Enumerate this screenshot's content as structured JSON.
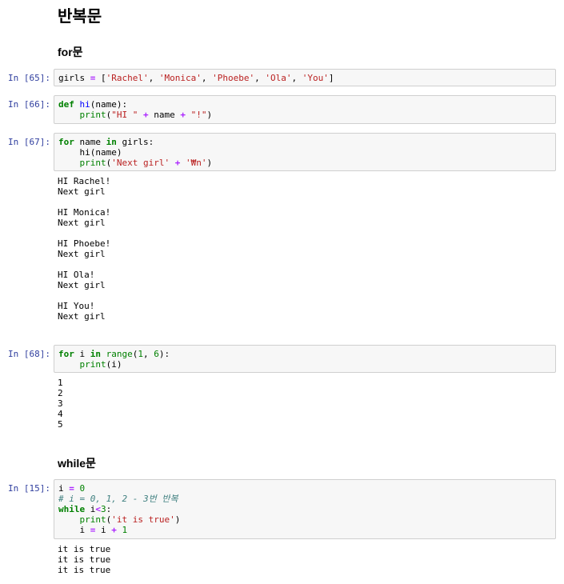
{
  "title": "반복문",
  "sections": {
    "for": "for문",
    "while": "while문"
  },
  "cells": [
    {
      "prompt": "In [65]:",
      "lines": [
        [
          [
            "t",
            "girls "
          ],
          [
            "op",
            "="
          ],
          [
            "t",
            " ["
          ],
          [
            "str",
            "'Rachel'"
          ],
          [
            "t",
            ", "
          ],
          [
            "str",
            "'Monica'"
          ],
          [
            "t",
            ", "
          ],
          [
            "str",
            "'Phoebe'"
          ],
          [
            "t",
            ", "
          ],
          [
            "str",
            "'Ola'"
          ],
          [
            "t",
            ", "
          ],
          [
            "str",
            "'You'"
          ],
          [
            "t",
            "]"
          ]
        ]
      ],
      "output": []
    },
    {
      "prompt": "In [66]:",
      "lines": [
        [
          [
            "kw",
            "def"
          ],
          [
            "t",
            " "
          ],
          [
            "fn",
            "hi"
          ],
          [
            "t",
            "(name):"
          ]
        ],
        [
          [
            "t",
            "    "
          ],
          [
            "bi",
            "print"
          ],
          [
            "t",
            "("
          ],
          [
            "str",
            "\"HI \""
          ],
          [
            "t",
            " "
          ],
          [
            "op",
            "+"
          ],
          [
            "t",
            " name "
          ],
          [
            "op",
            "+"
          ],
          [
            "t",
            " "
          ],
          [
            "str",
            "\"!\""
          ],
          [
            "t",
            ")"
          ]
        ]
      ],
      "output": []
    },
    {
      "prompt": "In [67]:",
      "lines": [
        [
          [
            "kw",
            "for"
          ],
          [
            "t",
            " name "
          ],
          [
            "kw",
            "in"
          ],
          [
            "t",
            " girls:"
          ]
        ],
        [
          [
            "t",
            "    hi(name)"
          ]
        ],
        [
          [
            "t",
            "    "
          ],
          [
            "bi",
            "print"
          ],
          [
            "t",
            "("
          ],
          [
            "str",
            "'Next girl'"
          ],
          [
            "t",
            " "
          ],
          [
            "op",
            "+"
          ],
          [
            "t",
            " "
          ],
          [
            "str",
            "'₩n'"
          ],
          [
            "t",
            ")"
          ]
        ]
      ],
      "output": [
        "HI Rachel!",
        "Next girl",
        "",
        "HI Monica!",
        "Next girl",
        "",
        "HI Phoebe!",
        "Next girl",
        "",
        "HI Ola!",
        "Next girl",
        "",
        "HI You!",
        "Next girl",
        ""
      ]
    },
    {
      "prompt": "In [68]:",
      "lines": [
        [
          [
            "kw",
            "for"
          ],
          [
            "t",
            " i "
          ],
          [
            "kw",
            "in"
          ],
          [
            "t",
            " "
          ],
          [
            "bi",
            "range"
          ],
          [
            "t",
            "("
          ],
          [
            "num",
            "1"
          ],
          [
            "t",
            ", "
          ],
          [
            "num",
            "6"
          ],
          [
            "t",
            "):"
          ]
        ],
        [
          [
            "t",
            "    "
          ],
          [
            "bi",
            "print"
          ],
          [
            "t",
            "(i)"
          ]
        ]
      ],
      "output": [
        "1",
        "2",
        "3",
        "4",
        "5"
      ]
    },
    {
      "prompt": "In [15]:",
      "lines": [
        [
          [
            "t",
            "i "
          ],
          [
            "op",
            "="
          ],
          [
            "t",
            " "
          ],
          [
            "num",
            "0"
          ]
        ],
        [
          [
            "cm",
            "# i = 0, 1, 2 - 3번 반복"
          ]
        ],
        [
          [
            "kw",
            "while"
          ],
          [
            "t",
            " i"
          ],
          [
            "op",
            "<"
          ],
          [
            "num",
            "3"
          ],
          [
            "t",
            ":"
          ]
        ],
        [
          [
            "t",
            "    "
          ],
          [
            "bi",
            "print"
          ],
          [
            "t",
            "("
          ],
          [
            "str",
            "'it is true'"
          ],
          [
            "t",
            ")"
          ]
        ],
        [
          [
            "t",
            "    i "
          ],
          [
            "op",
            "="
          ],
          [
            "t",
            " i "
          ],
          [
            "op",
            "+"
          ],
          [
            "t",
            " "
          ],
          [
            "num",
            "1"
          ]
        ]
      ],
      "output": [
        "it is true",
        "it is true",
        "it is true"
      ]
    }
  ]
}
